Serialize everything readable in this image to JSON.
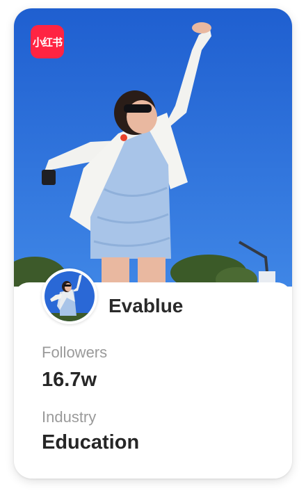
{
  "brand": {
    "logo_text": "小红书",
    "logo_color": "#ff2442"
  },
  "profile": {
    "name": "Evablue"
  },
  "stats": {
    "followers_label": "Followers",
    "followers_value": "16.7w",
    "industry_label": "Industry",
    "industry_value": "Education"
  },
  "colors": {
    "sky": "#2a68d6",
    "dress": "#a8c4e8",
    "shirt": "#f2f2ef"
  }
}
